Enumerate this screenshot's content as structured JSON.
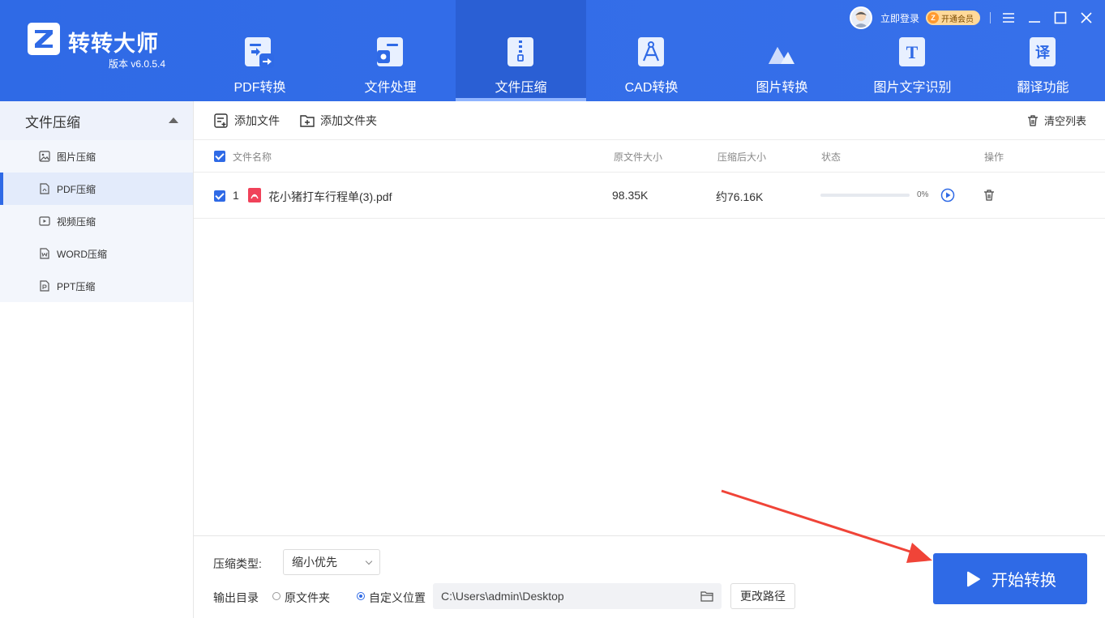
{
  "app": {
    "name": "转转大师",
    "version": "版本 v6.0.5.4"
  },
  "nav": {
    "tabs": [
      {
        "label": "PDF转换",
        "icon": "pdf-convert-icon"
      },
      {
        "label": "文件处理",
        "icon": "file-process-icon"
      },
      {
        "label": "文件压缩",
        "icon": "zip-icon",
        "active": true
      },
      {
        "label": "CAD转换",
        "icon": "cad-icon"
      },
      {
        "label": "图片转换",
        "icon": "image-convert-icon"
      },
      {
        "label": "图片文字识别",
        "icon": "ocr-icon"
      },
      {
        "label": "翻译功能",
        "icon": "translate-icon"
      }
    ],
    "ocr_glyph": "T",
    "translate_glyph": "译"
  },
  "account": {
    "login": "立即登录",
    "vip": "开通会员",
    "vip_badge": "Z"
  },
  "sidebar": {
    "title": "文件压缩",
    "items": [
      {
        "label": "图片压缩",
        "icon": "image-icon"
      },
      {
        "label": "PDF压缩",
        "icon": "pdf-file-icon",
        "active": true
      },
      {
        "label": "视频压缩",
        "icon": "video-icon"
      },
      {
        "label": "WORD压缩",
        "icon": "word-icon"
      },
      {
        "label": "PPT压缩",
        "icon": "ppt-icon"
      }
    ]
  },
  "toolbar": {
    "add_file": "添加文件",
    "add_folder": "添加文件夹",
    "clear_list": "清空列表"
  },
  "table": {
    "headers": {
      "name": "文件名称",
      "orig_size": "原文件大小",
      "comp_size": "压缩后大小",
      "status": "状态",
      "action": "操作"
    },
    "rows": [
      {
        "index": "1",
        "name": "花小猪打车行程单(3).pdf",
        "orig_size": "98.35K",
        "comp_size": "约76.16K",
        "progress": 0,
        "progress_label": "0%"
      }
    ]
  },
  "bottom": {
    "type_label": "压缩类型:",
    "type_value": "缩小优先",
    "output_label": "输出目录",
    "opt_original": "原文件夹",
    "opt_custom": "自定义位置",
    "path": "C:\\Users\\admin\\Desktop",
    "change_path": "更改路径",
    "start": "开始转换"
  },
  "colors": {
    "primary": "#2f6ae6",
    "header": "#3770ea",
    "annotation_arrow": "#f04438"
  }
}
